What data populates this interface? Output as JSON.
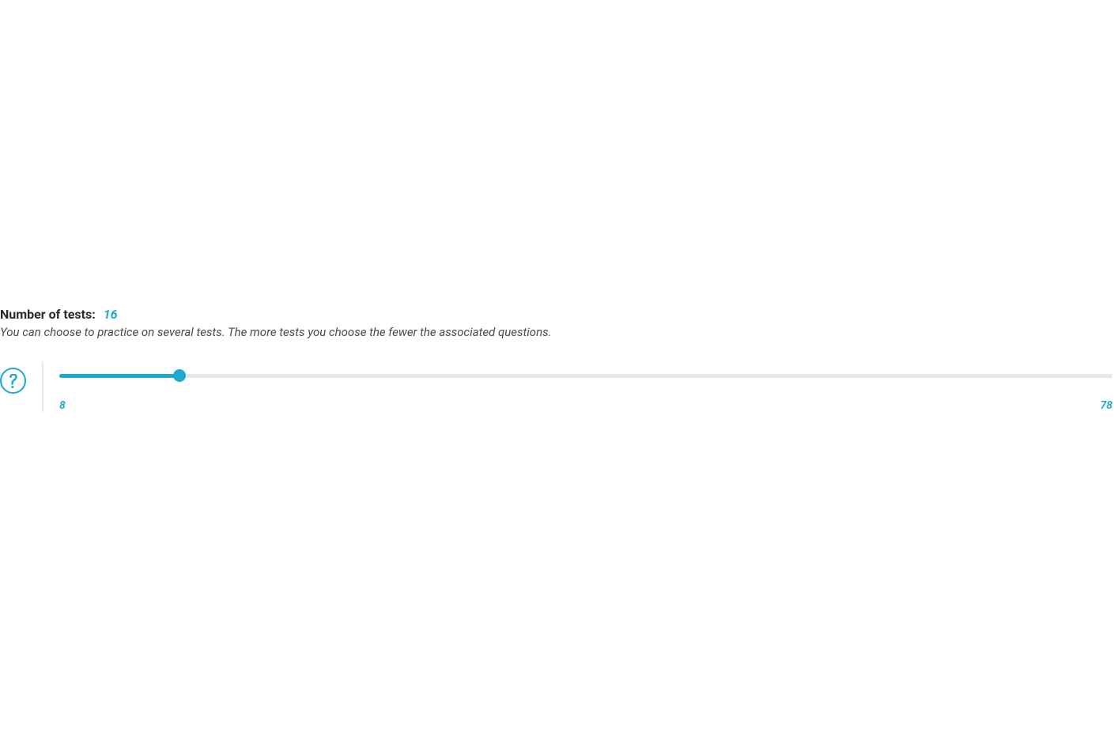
{
  "slider": {
    "title_label": "Number of tests:",
    "current_value": "16",
    "description": "You can choose to practice on several tests. The more tests you choose the fewer the associated questions.",
    "min_label": "8",
    "max_label": "78",
    "min": 8,
    "max": 78,
    "value": 16
  },
  "colors": {
    "accent": "#1da9d0",
    "text_primary": "#2a2a2a",
    "text_secondary": "#4a4a4a",
    "track_bg": "#e8e8e8"
  }
}
